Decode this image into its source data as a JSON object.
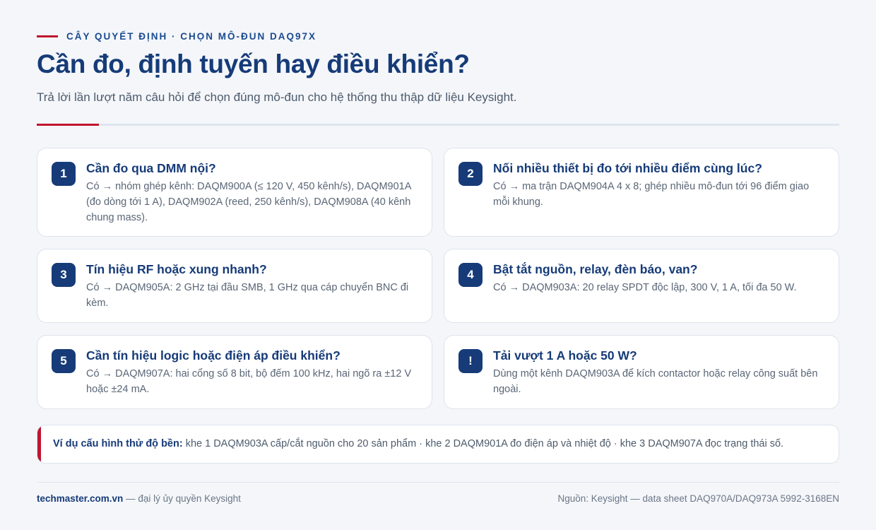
{
  "header": {
    "eyebrow": "CÂY QUYẾT ĐỊNH · CHỌN MÔ-ĐUN DAQ97X",
    "title": "Cần đo, định tuyến hay điều khiển?",
    "subtitle": "Trả lời lần lượt năm câu hỏi để chọn đúng mô-đun cho hệ thống thu thập dữ liệu Keysight."
  },
  "cards": [
    {
      "badge": "1",
      "question": "Cần đo qua DMM nội?",
      "answer": "Có → nhóm ghép kênh: DAQM900A (≤ 120 V, 450 kênh/s), DAQM901A (đo dòng tới 1 A), DAQM902A (reed, 250 kênh/s), DAQM908A (40 kênh chung mass)."
    },
    {
      "badge": "2",
      "question": "Nối nhiều thiết bị đo tới nhiều điểm cùng lúc?",
      "answer": "Có → ma trận DAQM904A 4 x 8; ghép nhiều mô-đun tới 96 điểm giao mỗi khung."
    },
    {
      "badge": "3",
      "question": "Tín hiệu RF hoặc xung nhanh?",
      "answer": "Có → DAQM905A: 2 GHz tại đầu SMB, 1 GHz qua cáp chuyển BNC đi kèm."
    },
    {
      "badge": "4",
      "question": "Bật tắt nguồn, relay, đèn báo, van?",
      "answer": "Có → DAQM903A: 20 relay SPDT độc lập, 300 V, 1 A, tối đa 50 W."
    },
    {
      "badge": "5",
      "question": "Cần tín hiệu logic hoặc điện áp điều khiển?",
      "answer": "Có → DAQM907A: hai cổng số 8 bit, bộ đếm 100 kHz, hai ngõ ra ±12 V hoặc ±24 mA."
    },
    {
      "badge": "!",
      "question": "Tải vượt 1 A hoặc 50 W?",
      "answer": "Dùng một kênh DAQM903A để kích contactor hoặc relay công suất bên ngoài."
    }
  ],
  "example": {
    "label": "Ví dụ cấu hình thử độ bền:",
    "text": " khe 1 DAQM903A cấp/cắt nguồn cho 20 sản phẩm · khe 2 DAQM901A đo điện áp và nhiệt độ · khe 3 DAQM907A đọc trạng thái số."
  },
  "footer": {
    "site": "techmaster.com.vn",
    "site_note": " — đại lý ủy quyền Keysight",
    "source": "Nguồn: Keysight — data sheet DAQ970A/DAQ973A 5992-3168EN"
  },
  "colors": {
    "accent": "#c0152f",
    "primary": "#163b78",
    "background": "#f4f6fa"
  }
}
